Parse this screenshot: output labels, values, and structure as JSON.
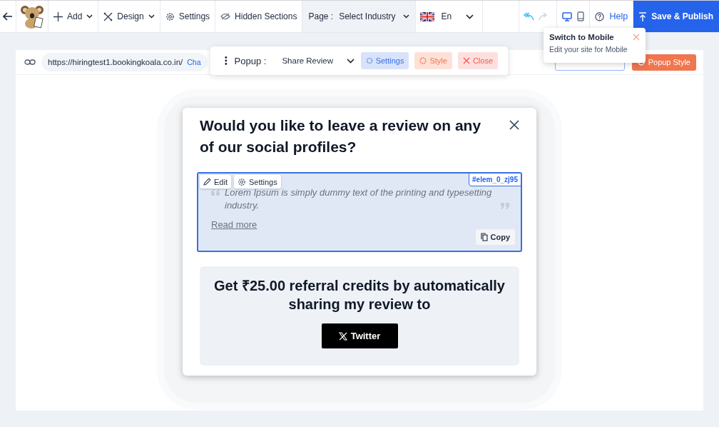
{
  "toolbar": {
    "menu": [
      {
        "kind": "add",
        "label": "Add",
        "dropdown": true
      },
      {
        "kind": "design",
        "label": "Design",
        "dropdown": true
      },
      {
        "kind": "settings",
        "label": "Settings",
        "dropdown": false
      },
      {
        "kind": "hidden",
        "label": "Hidden Sections",
        "dropdown": false
      }
    ],
    "page_select": {
      "label": "Page :",
      "value": "Select Industry"
    },
    "language": {
      "value": "En"
    },
    "undo": {
      "disabled": false
    },
    "redo": {
      "disabled": true
    },
    "devices": [
      {
        "kind": "desktop",
        "selected": true
      },
      {
        "kind": "mobile",
        "selected": false
      }
    ],
    "help": "Help",
    "publish": "Save & Publish"
  },
  "tooltip": {
    "title": "Switch to Mobile",
    "text": "Edit your site for Mobile"
  },
  "url_bar": {
    "url": "https://hiringtest1.bookingkoala.co.in/",
    "link": "Cha"
  },
  "popup_toolbar": {
    "label": "Popup :",
    "value": "Share Review",
    "buttons": [
      {
        "kind": "settings",
        "label": "Settings"
      },
      {
        "kind": "style",
        "label": "Style"
      },
      {
        "kind": "close",
        "label": "Close"
      }
    ]
  },
  "canvas_buttons": [
    {
      "kind": "outline"
    },
    {
      "kind": "filled",
      "label": "Popup Style"
    }
  ],
  "modal": {
    "title": "Would you like to leave a review on any of our social profiles?",
    "review": {
      "element_id": "#elem_0_zj95",
      "edit": "Edit",
      "settings": "Settings",
      "quote": "Lorem Ipsum is simply dummy text of the printing and typesetting industry.",
      "read_more": "Read more",
      "copy": "Copy"
    },
    "referral": {
      "text": "Get ₹25.00 referral credits by automatically sharing my review to",
      "button": "Twitter"
    }
  }
}
